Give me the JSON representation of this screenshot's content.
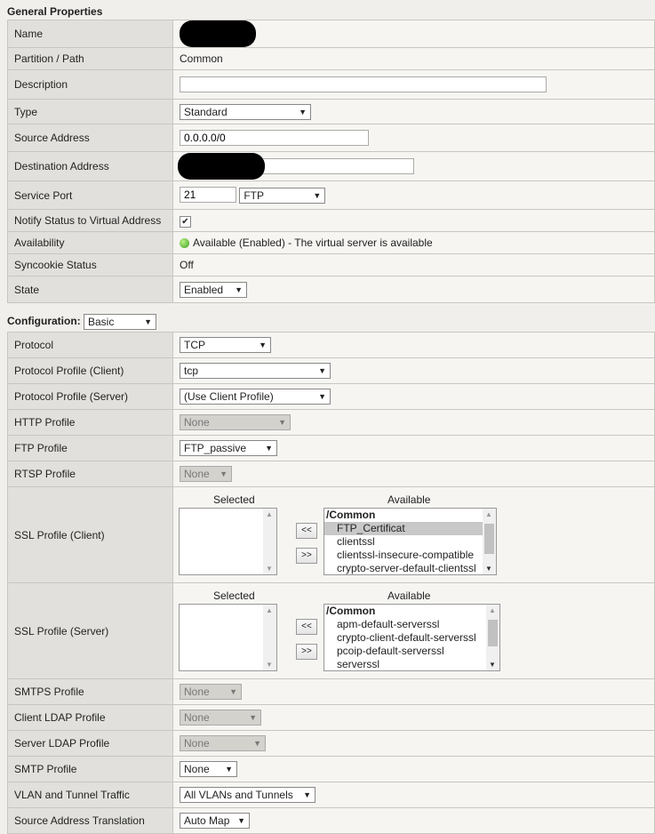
{
  "general": {
    "title": "General Properties",
    "rows": {
      "name": "Name",
      "partition": "Partition / Path",
      "partition_val": "Common",
      "description": "Description",
      "description_val": "",
      "type": "Type",
      "type_val": "Standard",
      "source": "Source Address",
      "source_val": "0.0.0.0/0",
      "dest": "Destination Address",
      "dest_val": "",
      "port": "Service Port",
      "port_val": "21",
      "port_svc": "FTP",
      "notify": "Notify Status to Virtual Address",
      "notify_checked": true,
      "availability": "Availability",
      "availability_val": "Available (Enabled) - The virtual server is available",
      "syncookie": "Syncookie Status",
      "syncookie_val": "Off",
      "state": "State",
      "state_val": "Enabled"
    }
  },
  "config": {
    "title": "Configuration:",
    "mode": "Basic",
    "protocol": "Protocol",
    "protocol_val": "TCP",
    "ppc": "Protocol Profile (Client)",
    "ppc_val": "tcp",
    "pps": "Protocol Profile (Server)",
    "pps_val": "(Use Client Profile)",
    "http": "HTTP Profile",
    "http_val": "None",
    "ftp": "FTP Profile",
    "ftp_val": "FTP_passive",
    "rtsp": "RTSP Profile",
    "rtsp_val": "None",
    "sslc": "SSL Profile (Client)",
    "ssls": "SSL Profile (Server)",
    "selected": "Selected",
    "available": "Available",
    "move_left": "<<",
    "move_right": ">>",
    "sslc_available": [
      "/Common",
      "FTP_Certificat",
      "clientssl",
      "clientssl-insecure-compatible",
      "crypto-server-default-clientssl"
    ],
    "ssls_available": [
      "/Common",
      "apm-default-serverssl",
      "crypto-client-default-serverssl",
      "pcoip-default-serverssl",
      "serverssl"
    ],
    "smtps": "SMTPS Profile",
    "smtps_val": "None",
    "cldap": "Client LDAP Profile",
    "cldap_val": "None",
    "sldap": "Server LDAP Profile",
    "sldap_val": "None",
    "smtp": "SMTP Profile",
    "smtp_val": "None",
    "vlan": "VLAN and Tunnel Traffic",
    "vlan_val": "All VLANs and Tunnels",
    "sat": "Source Address Translation",
    "sat_val": "Auto Map"
  },
  "colors": {
    "label_bg": "#e1e0dc",
    "value_bg": "#f6f5f2",
    "available_green": "#3ca018"
  }
}
